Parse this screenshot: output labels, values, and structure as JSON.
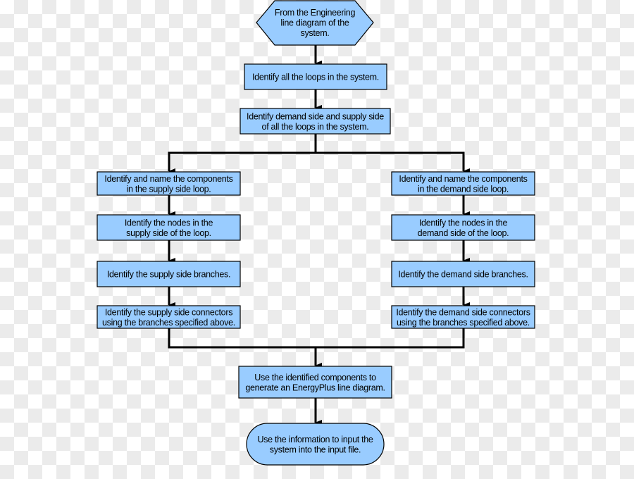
{
  "colors": {
    "node_fill": "#99ccff",
    "line": "#000000",
    "text": "#000000"
  },
  "nodes": {
    "start": [
      "From the Engineering",
      "line diagram of the",
      "system."
    ],
    "loops": [
      "Identify all the loops in the system."
    ],
    "sides": [
      "Identify demand side and supply side",
      "of all the loops in the system."
    ],
    "supply_components": [
      "Identify and name the components",
      "in the supply side loop."
    ],
    "supply_nodes": [
      "Identify the nodes in the",
      "supply side of the loop."
    ],
    "supply_branches": [
      "Identify the supply side branches."
    ],
    "supply_connectors": [
      "Identify the supply side connectors",
      "using the branches specified above."
    ],
    "demand_components": [
      "Identify and name the components",
      "in the demand side loop."
    ],
    "demand_nodes": [
      "Identify the nodes in the",
      "demand side of the loop."
    ],
    "demand_branches": [
      "Identify the demand side branches."
    ],
    "demand_connectors": [
      "Identify the demand side connectors",
      "using the branches specified above."
    ],
    "line_diagram": [
      "Use the identified components to",
      "generate an EnergyPlus line diagram."
    ],
    "end": [
      "Use the information to input the",
      "system into the input file."
    ]
  }
}
